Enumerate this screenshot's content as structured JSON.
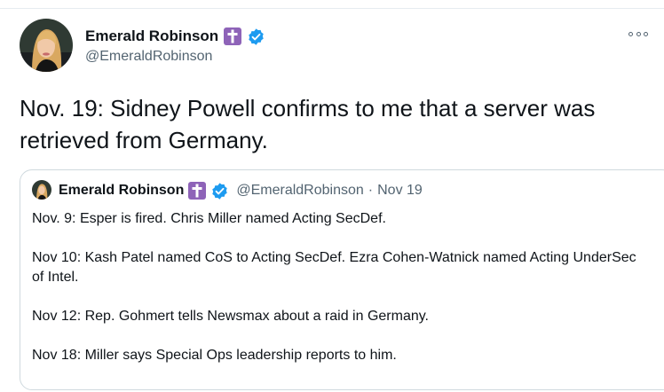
{
  "tweet": {
    "author_name": "Emerald Robinson",
    "author_handle": "@EmeraldRobinson",
    "text": "Nov. 19: Sidney Powell confirms to me that a server was retrieved from Germany."
  },
  "quoted_tweet": {
    "author_name": "Emerald Robinson",
    "author_handle": "@EmeraldRobinson",
    "separator": "·",
    "date": "Nov 19",
    "lines": [
      "Nov. 9: Esper is fired. Chris Miller named Acting SecDef.",
      "Nov 10: Kash Patel named CoS to Acting SecDef. Ezra Cohen-Watnick named Acting UnderSec of Intel.",
      "Nov 12: Rep. Gohmert tells Newsmax about a raid in Germany.",
      "Nov 18: Miller says Special Ops leadership reports to him."
    ]
  },
  "icons": {
    "badge": "latin-cross-icon",
    "verified": "verified-check-icon",
    "more": "more-options-icon"
  },
  "colors": {
    "cross_badge": "#8e63b8",
    "verified": "#1d9bf0",
    "secondary_text": "#536471",
    "border": "#cfd9de"
  }
}
